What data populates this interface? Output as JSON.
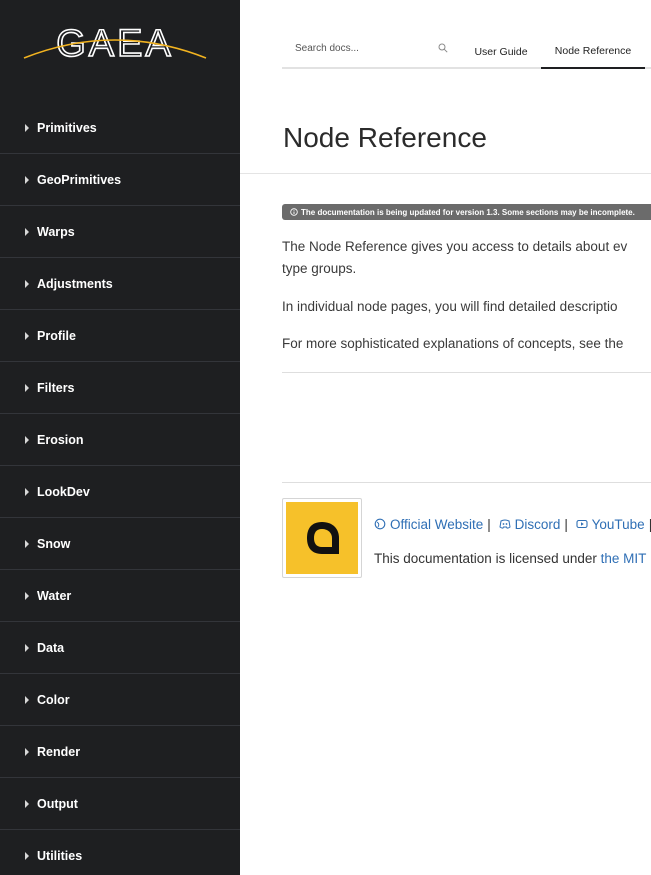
{
  "brand": {
    "logo_text": "GAEA",
    "accent": "#f2b320"
  },
  "sidebar": {
    "items": [
      {
        "label": "Primitives"
      },
      {
        "label": "GeoPrimitives"
      },
      {
        "label": "Warps"
      },
      {
        "label": "Adjustments"
      },
      {
        "label": "Profile"
      },
      {
        "label": "Filters"
      },
      {
        "label": "Erosion"
      },
      {
        "label": "LookDev"
      },
      {
        "label": "Snow"
      },
      {
        "label": "Water"
      },
      {
        "label": "Data"
      },
      {
        "label": "Color"
      },
      {
        "label": "Render"
      },
      {
        "label": "Output"
      },
      {
        "label": "Utilities"
      }
    ]
  },
  "header": {
    "search_placeholder": "Search docs...",
    "tabs": [
      {
        "label": "User Guide",
        "active": false
      },
      {
        "label": "Node Reference",
        "active": true
      }
    ]
  },
  "main": {
    "title": "Node Reference",
    "notice": "The documentation is being updated for version 1.3. Some sections may be incomplete.",
    "paragraph1_line1": "The Node Reference gives you access to details about ev",
    "paragraph1_line2": "type groups.",
    "paragraph2": "In individual node pages, you will find detailed descriptio",
    "paragraph3": "For more sophisticated explanations of concepts, see the"
  },
  "footer": {
    "links": [
      {
        "label": "Official Website",
        "icon": "globe-icon"
      },
      {
        "label": "Discord",
        "icon": "discord-icon"
      },
      {
        "label": "YouTube",
        "icon": "youtube-icon"
      }
    ],
    "separator": "|",
    "license_prefix": "This documentation is licensed under ",
    "license_link": "the MIT",
    "badge_letter": "Q",
    "badge_color": "#f6c12a"
  }
}
